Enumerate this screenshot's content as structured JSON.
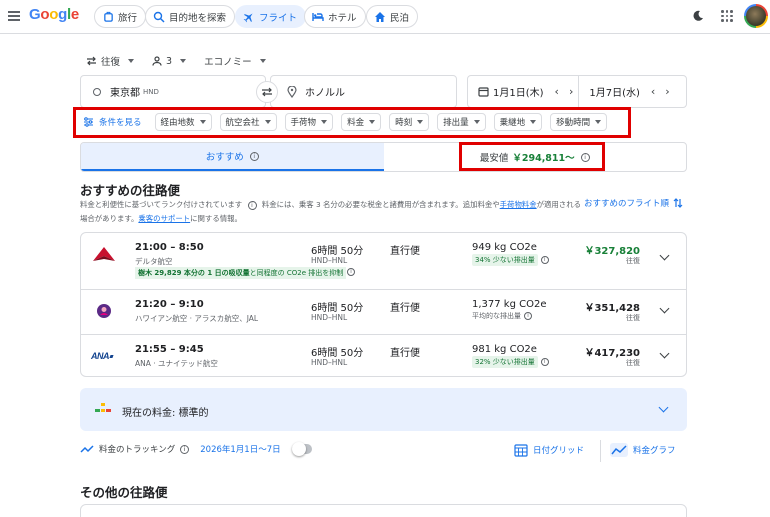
{
  "header": {
    "logo": "Google",
    "nav": [
      {
        "label": "旅行",
        "icon": "travel-icon"
      },
      {
        "label": "目的地を探索",
        "icon": "explore-icon"
      },
      {
        "label": "フライト",
        "icon": "flight-icon",
        "active": true
      },
      {
        "label": "ホテル",
        "icon": "hotel-icon"
      },
      {
        "label": "民泊",
        "icon": "home-icon"
      }
    ]
  },
  "search": {
    "trip_type": "往復",
    "passengers": "3",
    "cabin": "エコノミー",
    "origin": "東京都",
    "origin_code": "HND",
    "destination": "ホノルル",
    "depart_date": "1月1日(木)",
    "return_date": "1月7日(水)"
  },
  "filters": {
    "all_label": "条件を見る",
    "items": [
      "経由地数",
      "航空会社",
      "手荷物",
      "料金",
      "時刻",
      "排出量",
      "乗継地",
      "移動時間"
    ]
  },
  "tabs": {
    "best_label": "おすすめ",
    "cheapest_label": "最安値",
    "cheapest_price": "￥294,811～"
  },
  "best": {
    "heading": "おすすめの往路便",
    "note_part1": "料金と利便性に基づいてランク付けされています",
    "note_part2": "料金には、乗客 3 名分の必要な税金と諸費用が含まれます。追加料金や",
    "note_link1": "手荷物料金",
    "note_part3": "が適用される場合があります。",
    "note_link2": "乗客のサポート",
    "note_part4": "に関する情報。",
    "sort_label": "おすすめのフライト順"
  },
  "flights": [
    {
      "time": "21:00 – 8:50",
      "airline": "デルタ航空",
      "duration": "6時間 50分",
      "route": "HND–HNL",
      "stops": "直行便",
      "co2": "949 kg CO2e",
      "co2_note": "34% 少ない排出量",
      "price": "￥327,820",
      "price_type": "往復",
      "eco_bold": "樹木 29,829 本分の 1 日の吸収量",
      "eco_tail": "と同程度の CO2e 排出を抑制"
    },
    {
      "time": "21:20 – 9:10",
      "airline": "ハワイアン航空 · アラスカ航空、JAL",
      "duration": "6時間 50分",
      "route": "HND–HNL",
      "stops": "直行便",
      "co2": "1,377 kg CO2e",
      "co2_note": "平均的な排出量",
      "price": "￥351,428",
      "price_type": "往復"
    },
    {
      "time": "21:55 – 9:45",
      "airline": "ANA · ユナイテッド航空",
      "duration": "6時間 50分",
      "route": "HND–HNL",
      "stops": "直行便",
      "co2": "981 kg CO2e",
      "co2_note": "32% 少ない排出量",
      "price": "￥417,230",
      "price_type": "往復"
    }
  ],
  "price_insight": {
    "label": "現在の料金: 標準的"
  },
  "tracking": {
    "label": "料金のトラッキング",
    "dates": "2026年1月1日～7日",
    "grid_label": "日付グリッド",
    "graph_label": "料金グラフ"
  },
  "other": {
    "heading": "その他の往路便"
  },
  "colors": {
    "accent": "#1a73e8",
    "green": "#188038",
    "highlight": "#e00000"
  }
}
